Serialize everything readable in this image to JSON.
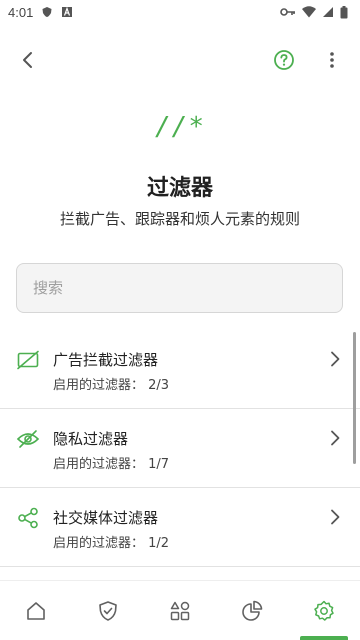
{
  "status_bar": {
    "time": "4:01"
  },
  "header": {
    "hero_glyph": "//*",
    "title": "过滤器",
    "subtitle": "拦截广告、跟踪器和烦人元素的规则"
  },
  "search": {
    "placeholder": "搜索",
    "value": ""
  },
  "filter_groups": [
    {
      "icon": "ad-block-icon",
      "title": "广告拦截过滤器",
      "subtitle": "启用的过滤器： 2/3"
    },
    {
      "icon": "eye-off-icon",
      "title": "隐私过滤器",
      "subtitle": "启用的过滤器： 1/7"
    },
    {
      "icon": "share-icon",
      "title": "社交媒体过滤器",
      "subtitle": "启用的过滤器： 1/2"
    }
  ],
  "bottom_nav": {
    "items": [
      "home-icon",
      "shield-check-icon",
      "apps-icon",
      "pie-chart-icon",
      "settings-icon"
    ],
    "active": "settings-icon"
  },
  "colors": {
    "accent": "#4caf50",
    "text_primary": "#212121",
    "text_secondary": "#444444",
    "icon_gray": "#616161"
  }
}
